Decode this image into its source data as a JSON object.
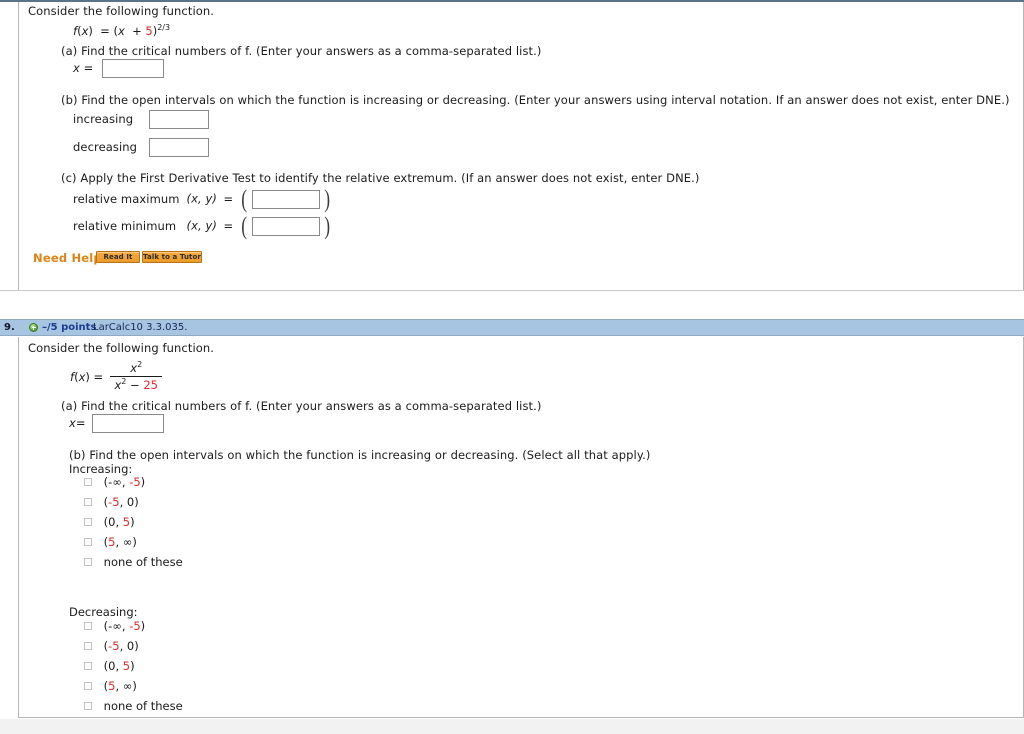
{
  "question8": {
    "prompt": "Consider the following function.",
    "formula": {
      "text": "f(x) = (x + 5)",
      "base_open": "(",
      "var": "x",
      "plus": "+",
      "const": "5",
      "base_close": ")",
      "exponent": "2/3"
    },
    "part_a": {
      "text": "(a) Find the critical numbers of f. (Enter your answers as a comma-separated list.)",
      "label": "x =",
      "value": ""
    },
    "part_b": {
      "text": "(b) Find the open intervals on which the function is increasing or decreasing. (Enter your answers using interval notation. If an answer does not exist, enter DNE.)",
      "rows": [
        {
          "label": "increasing",
          "value": ""
        },
        {
          "label": "decreasing",
          "value": ""
        }
      ]
    },
    "part_c": {
      "text": "(c) Apply the First Derivative Test to identify the relative extremum. (If an answer does not exist, enter DNE.)",
      "rows": [
        {
          "label": "relative maximum",
          "coord": "(x, y)",
          "equals": "=",
          "value": ""
        },
        {
          "label": "relative minimum",
          "coord": "(x, y)",
          "equals": "=",
          "value": ""
        }
      ]
    },
    "need_help": {
      "label": "Need Help?",
      "buttons": [
        {
          "label": "Read It"
        },
        {
          "label": "Talk to a Tutor"
        }
      ]
    }
  },
  "question9": {
    "number": "9.",
    "points": "–/5 points",
    "reference": "LarCalc10 3.3.035.",
    "icon": "plus-circle-icon",
    "prompt": "Consider the following function.",
    "formula": {
      "lhs": "f(x) =",
      "numerator_var": "x",
      "numerator_exp": "2",
      "denominator_var": "x",
      "denominator_exp": "2",
      "denominator_minus": "−",
      "denominator_const": "25"
    },
    "part_a": {
      "text": "(a) Find the critical numbers of f. (Enter your answers as a comma-separated list.)",
      "label": "x=",
      "value": ""
    },
    "part_b": {
      "text": "(b) Find the open intervals on which the function is increasing or decreasing. (Select all that apply.)",
      "increasing_label": "Increasing:",
      "decreasing_label": "Decreasing:",
      "options": [
        {
          "pre": "(-∞, ",
          "red": "-5",
          "post": ")",
          "plain": ""
        },
        {
          "pre": "(",
          "red": "-5",
          "post": ", 0)",
          "plain": ""
        },
        {
          "pre": "(0, ",
          "red": "5",
          "post": ")",
          "plain": ""
        },
        {
          "pre": "(",
          "red": "5",
          "post": ", ∞)",
          "plain": ""
        },
        {
          "pre": "",
          "red": "",
          "post": "",
          "plain": "none of these"
        }
      ]
    }
  },
  "colors": {
    "accent_red": "#e8262c",
    "header_blue": "#a7c4e0",
    "help_orange": "#e08214",
    "points_blue": "#1c3d8f"
  }
}
